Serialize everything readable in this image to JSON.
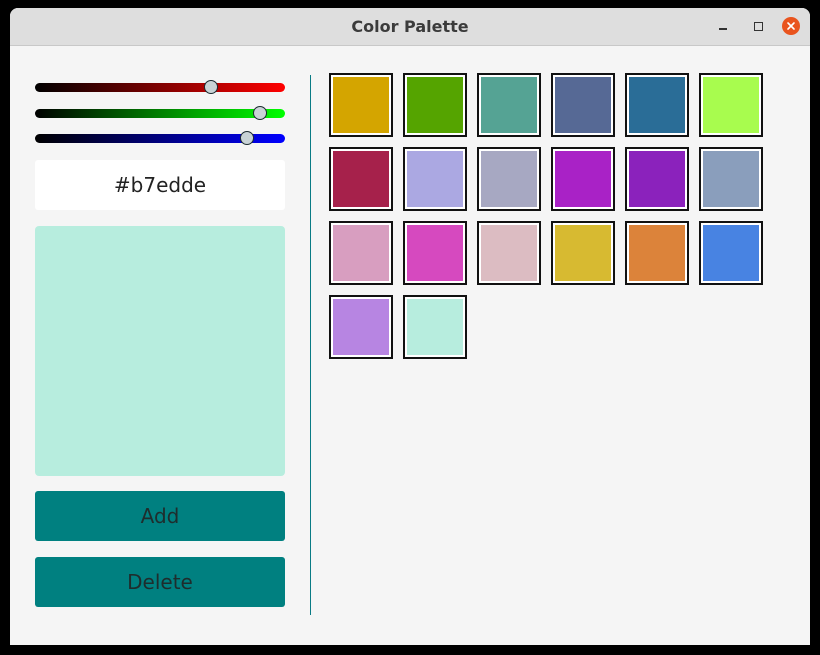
{
  "window": {
    "title": "Color Palette"
  },
  "sliders": {
    "red": {
      "value": 183,
      "max": 255,
      "color": "#ff0000"
    },
    "green": {
      "value": 237,
      "max": 255,
      "color": "#00ff00"
    },
    "blue": {
      "value": 222,
      "max": 255,
      "color": "#0000ff"
    }
  },
  "hex_value": "#b7edde",
  "preview_color": "#b7edde",
  "buttons": {
    "add_label": "Add",
    "delete_label": "Delete",
    "accent_color": "#008080"
  },
  "palette": [
    "#d4a500",
    "#55a400",
    "#55a394",
    "#566995",
    "#2a6d97",
    "#a8fc4e",
    "#a6214b",
    "#aba8e2",
    "#a7a8c2",
    "#a922c6",
    "#8b22bc",
    "#8a9ebc",
    "#d89ec0",
    "#d649bf",
    "#dcbcc2",
    "#d7ba31",
    "#dc833a",
    "#4883e2",
    "#b785e2",
    "#b7edde"
  ]
}
